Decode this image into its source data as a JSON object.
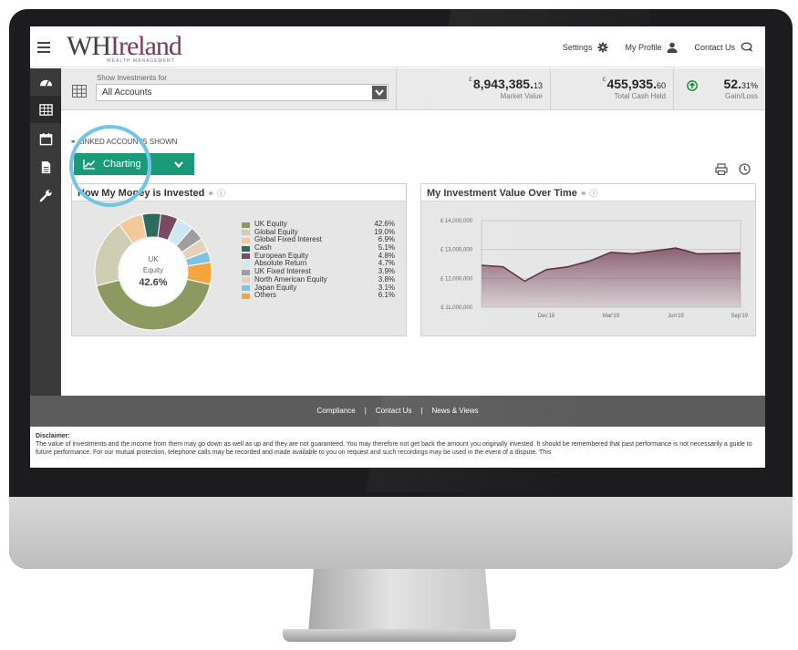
{
  "app": {
    "logo_main": "WH",
    "logo_accent": "Ireland",
    "logo_subtitle": "WEALTH MANAGEMENT"
  },
  "topnav": {
    "settings": "Settings",
    "profile": "My Profile",
    "contact": "Contact Us"
  },
  "sidebar": {
    "icons": [
      "dashboard-icon",
      "grid-icon",
      "calendar-icon",
      "document-icon",
      "wrench-icon"
    ],
    "active_index": 1
  },
  "filter": {
    "label": "Show Investments for",
    "value": "All Accounts"
  },
  "metrics": {
    "market_value": {
      "currency": "£",
      "whole": "8,943,385.",
      "decimals": "13",
      "label": "Market Value"
    },
    "cash_held": {
      "currency": "£",
      "whole": "455,935.",
      "decimals": "60",
      "label": "Total Cash Held"
    },
    "gain_loss": {
      "whole": "52.",
      "decimals": "31%",
      "label": "Gain/Loss",
      "direction": "up",
      "color": "#1a8a2e"
    }
  },
  "linked_accounts_text": "LINKED ACCOUNTS SHOWN",
  "charting_button": "Charting",
  "allocation": {
    "title": "How My Money is Invested",
    "center_line1": "UK",
    "center_line2": "Equity",
    "center_value": "42.6%"
  },
  "value_chart": {
    "title": "My Investment Value Over Time"
  },
  "chart_data": [
    {
      "type": "pie",
      "title": "How My Money is Invested",
      "donut": true,
      "categories": [
        "UK Equity",
        "Global Equity",
        "Global Fixed Interest",
        "Cash",
        "European Equity",
        "Absolute Return",
        "UK Fixed Interest",
        "North American Equity",
        "Japan Equity",
        "Others"
      ],
      "values": [
        42.6,
        19.0,
        6.9,
        5.1,
        4.8,
        4.7,
        3.9,
        3.8,
        3.1,
        6.1
      ],
      "labels": [
        "42.6%",
        "19.0%",
        "6.9%",
        "5.1%",
        "4.8%",
        "4.7%",
        "3.9%",
        "3.8%",
        "3.1%",
        "6.1%"
      ],
      "colors": [
        "#8c9a62",
        "#cfcdb4",
        "#f3c99b",
        "#2e6b5f",
        "#7a4a63",
        "#cfe6f3",
        "#9e9e9e",
        "#e3d3bb",
        "#7dc4e4",
        "#f5a540"
      ],
      "legend": "right"
    },
    {
      "type": "area",
      "title": "My Investment Value Over Time",
      "x": [
        "Sep'18",
        "Oct'18",
        "Nov'18",
        "Dec'18",
        "Jan'19",
        "Feb'19",
        "Mar'19",
        "Apr'19",
        "May'19",
        "Jun'19",
        "Jul'19",
        "Aug'19",
        "Sep'19"
      ],
      "xticks": [
        "Dec'18",
        "Mar'19",
        "Jun'19",
        "Sep'19"
      ],
      "y": [
        12450000,
        12400000,
        11900000,
        12300000,
        12400000,
        12600000,
        12900000,
        12850000,
        12950000,
        13050000,
        12850000,
        12860000,
        12880000
      ],
      "yticks": [
        "£ 11,000,000",
        "£ 12,000,000",
        "£ 13,000,000",
        "£ 14,000,000"
      ],
      "ylim": [
        11000000,
        14000000
      ],
      "grid": true,
      "color": "#7b4a5e"
    }
  ],
  "footer": {
    "links": [
      "Compliance",
      "Contact Us",
      "News & Views"
    ],
    "separator": "|"
  },
  "disclaimer": {
    "heading": "Disclaimer:",
    "text": "The value of investments and the income from them may go down as well as up and they are not guaranteed. You may therefore not get back the amount you originally invested. It should be remembered that past performance is not necessarily a guide to future performance. For our mutual protection, telephone calls may be recorded and made available to you on request and such recordings may be used in the event of a dispute. This"
  }
}
